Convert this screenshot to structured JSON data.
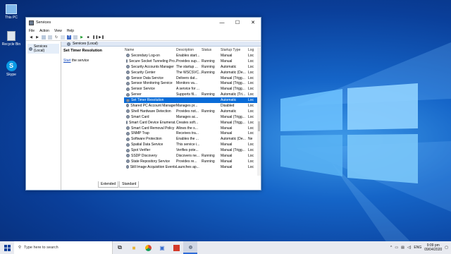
{
  "desktop": {
    "icons": [
      {
        "label": "This PC",
        "icon": "this-pc-icon"
      },
      {
        "label": "Recycle Bin",
        "icon": "recycle-bin-icon"
      },
      {
        "label": "Skype",
        "icon": "skype-icon"
      }
    ]
  },
  "window": {
    "title": "Services",
    "controls": {
      "minimize": "—",
      "maximize": "☐",
      "close": "✕"
    },
    "menu": [
      "File",
      "Action",
      "View",
      "Help"
    ],
    "tree": {
      "label": "Services (Local)"
    },
    "header": {
      "label": "Services (Local)"
    },
    "detail": {
      "title": "Set Timer Resolution",
      "link_text": "Start",
      "link_suffix": " the service"
    },
    "columns": [
      "Name",
      "Description",
      "Status",
      "Startup Type",
      "Log"
    ],
    "rows": [
      {
        "name": "Secondary Log-on",
        "desc": "Enables start...",
        "status": "",
        "start": "Manual",
        "log": "Loc"
      },
      {
        "name": "Secure Socket Tunneling Pro...",
        "desc": "Provides sup...",
        "status": "Running",
        "start": "Manual",
        "log": "Loc"
      },
      {
        "name": "Security Accounts Manager",
        "desc": "The startup ...",
        "status": "Running",
        "start": "Automatic",
        "log": "Loc"
      },
      {
        "name": "Security Center",
        "desc": "The WSCSVC...",
        "status": "Running",
        "start": "Automatic (De...",
        "log": "Loc"
      },
      {
        "name": "Sensor Data Service",
        "desc": "Delivers dat...",
        "status": "",
        "start": "Manual (Trigg...",
        "log": "Loc"
      },
      {
        "name": "Sensor Monitoring Service",
        "desc": "Monitors va...",
        "status": "",
        "start": "Manual (Trigg...",
        "log": "Loc"
      },
      {
        "name": "Sensor Service",
        "desc": "A service for ...",
        "status": "",
        "start": "Manual (Trigg...",
        "log": "Loc"
      },
      {
        "name": "Server",
        "desc": "Supports fil...",
        "status": "Running",
        "start": "Automatic (Tri...",
        "log": "Loc"
      },
      {
        "name": "Set Timer Resolution",
        "desc": "",
        "status": "",
        "start": "Automatic",
        "log": "Loc",
        "selected": true
      },
      {
        "name": "Shared PC Account Manager",
        "desc": "Manages pr...",
        "status": "",
        "start": "Disabled",
        "log": "Loc"
      },
      {
        "name": "Shell Hardware Detection",
        "desc": "Provides not...",
        "status": "Running",
        "start": "Automatic",
        "log": "Loc"
      },
      {
        "name": "Smart Card",
        "desc": "Manages ac...",
        "status": "",
        "start": "Manual (Trigg...",
        "log": "Loc"
      },
      {
        "name": "Smart Card Device Enumerat...",
        "desc": "Creates soft...",
        "status": "",
        "start": "Manual (Trigg...",
        "log": "Loc"
      },
      {
        "name": "Smart Card Removal Policy",
        "desc": "Allows the s...",
        "status": "",
        "start": "Manual",
        "log": "Loc"
      },
      {
        "name": "SNMP Trap",
        "desc": "Receives tra...",
        "status": "",
        "start": "Manual",
        "log": "Loc"
      },
      {
        "name": "Software Protection",
        "desc": "Enables the ...",
        "status": "",
        "start": "Automatic (De...",
        "log": "Ne"
      },
      {
        "name": "Spatial Data Service",
        "desc": "This service i...",
        "status": "",
        "start": "Manual",
        "log": "Loc"
      },
      {
        "name": "Spot Verifier",
        "desc": "Verifies pote...",
        "status": "",
        "start": "Manual (Trigg...",
        "log": "Loc"
      },
      {
        "name": "SSDP Discovery",
        "desc": "Discovers ne...",
        "status": "Running",
        "start": "Manual",
        "log": "Loc"
      },
      {
        "name": "State Repository Service",
        "desc": "Provides re...",
        "status": "Running",
        "start": "Manual",
        "log": "Loc"
      },
      {
        "name": "Still Image Acquisition Events",
        "desc": "Launches ap...",
        "status": "",
        "start": "Manual",
        "log": "Loc"
      }
    ],
    "tabs": [
      "Extended",
      "Standard"
    ]
  },
  "taskbar": {
    "search_placeholder": "Type here to search",
    "tray": {
      "lang": "ENG",
      "time": "9:09 pm",
      "date": "09/04/2020"
    }
  }
}
